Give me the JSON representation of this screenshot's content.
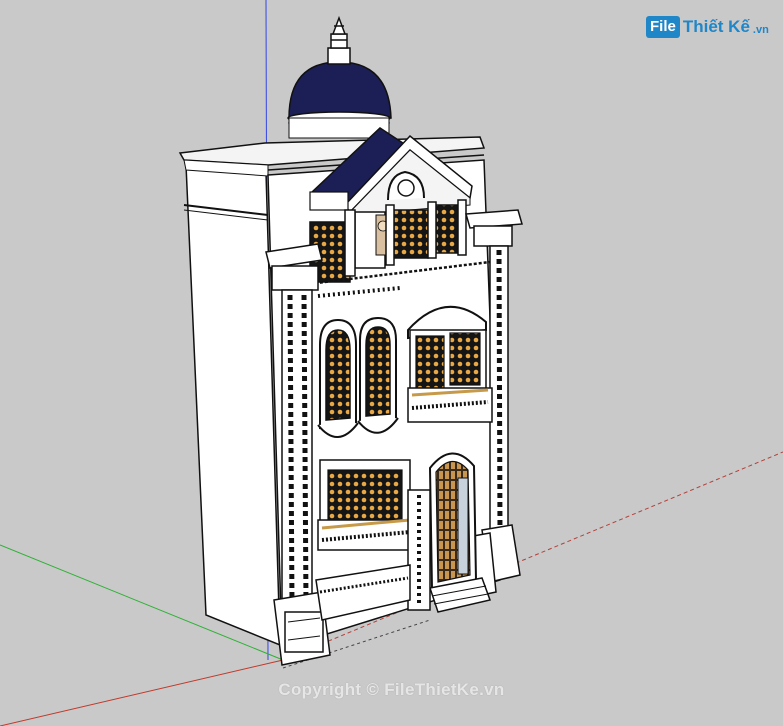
{
  "logo": {
    "box_text": "File",
    "main_text": "Thiết Kế",
    "tld": ".vn"
  },
  "watermark": {
    "text": "Copyright © FileThietKe.vn"
  },
  "colors": {
    "background": "#c9c9c9",
    "wall": "#ffffff",
    "dome": "#1c1f55",
    "window_glass": "#e0a341",
    "axis_red": "#c0392b",
    "axis_green": "#2eb135",
    "axis_blue": "#3346e8",
    "brand": "#1f86c8"
  }
}
